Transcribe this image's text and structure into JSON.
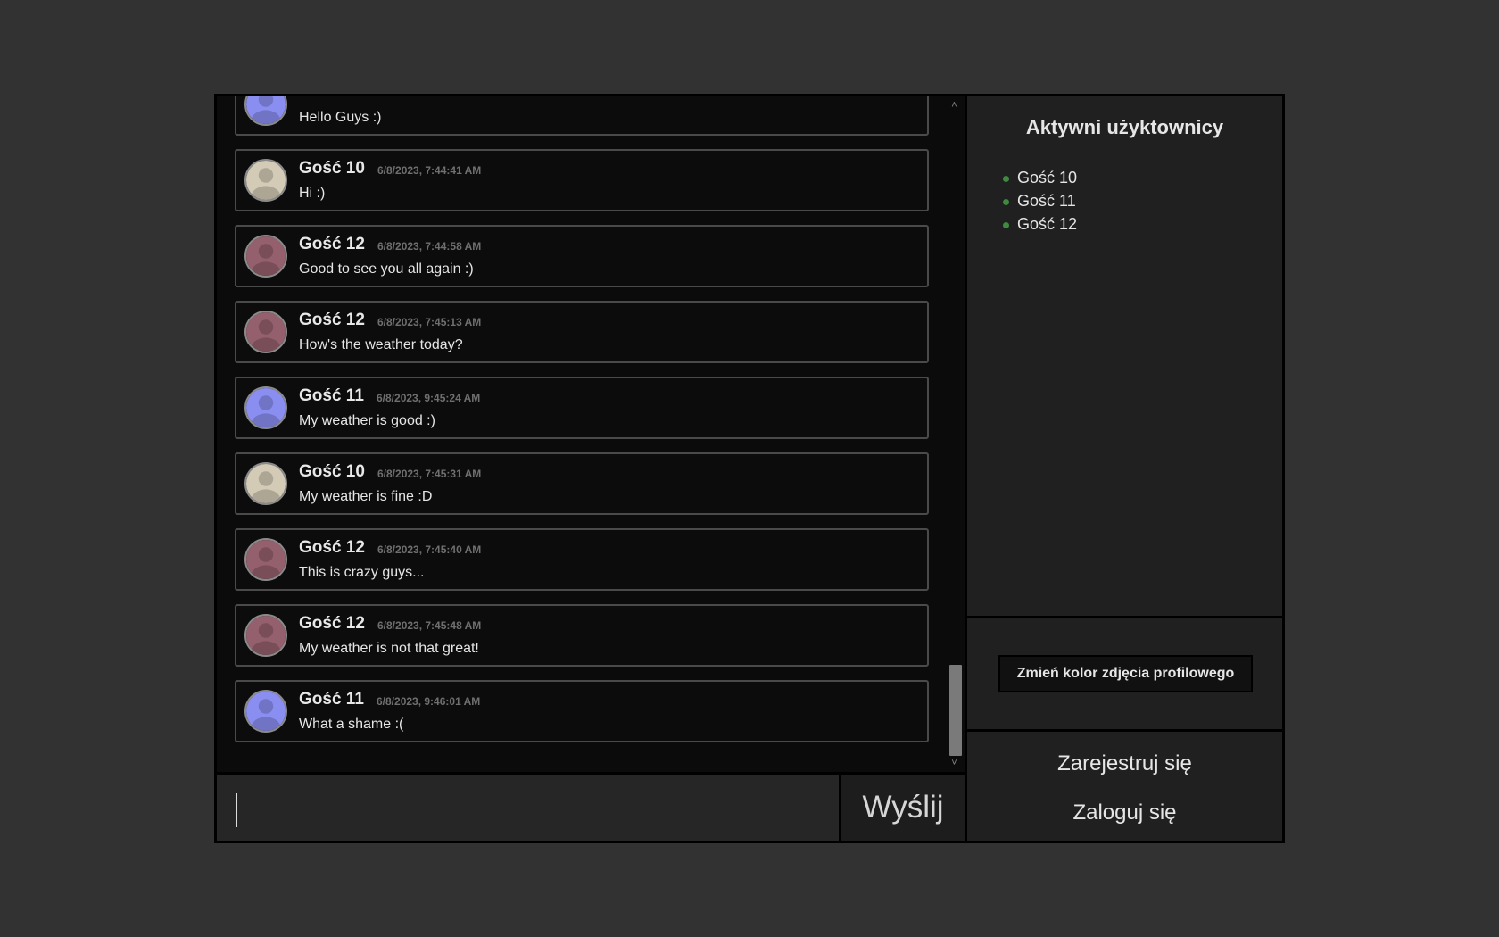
{
  "messages": [
    {
      "author": "",
      "time": "",
      "text": "Hello Guys :)",
      "avatar_color": "#8a8ef0"
    },
    {
      "author": "Gość 10",
      "time": "6/8/2023, 7:44:41 AM",
      "text": "Hi :)",
      "avatar_color": "#d3cbb5"
    },
    {
      "author": "Gość 12",
      "time": "6/8/2023, 7:44:58 AM",
      "text": "Good to see you all again :)",
      "avatar_color": "#94606d"
    },
    {
      "author": "Gość 12",
      "time": "6/8/2023, 7:45:13 AM",
      "text": "How's the weather today?",
      "avatar_color": "#94606d"
    },
    {
      "author": "Gość 11",
      "time": "6/8/2023, 9:45:24 AM",
      "text": "My weather is good :)",
      "avatar_color": "#8a8ef0"
    },
    {
      "author": "Gość 10",
      "time": "6/8/2023, 7:45:31 AM",
      "text": "My weather is fine :D",
      "avatar_color": "#d3cbb5"
    },
    {
      "author": "Gość 12",
      "time": "6/8/2023, 7:45:40 AM",
      "text": "This is crazy guys...",
      "avatar_color": "#94606d"
    },
    {
      "author": "Gość 12",
      "time": "6/8/2023, 7:45:48 AM",
      "text": "My weather is not that great!",
      "avatar_color": "#94606d"
    },
    {
      "author": "Gość 11",
      "time": "6/8/2023, 9:46:01 AM",
      "text": "What a shame :(",
      "avatar_color": "#8a8ef0"
    }
  ],
  "composer": {
    "input_value": "",
    "send_label": "Wyślij"
  },
  "sidebar": {
    "title": "Aktywni użyktownicy",
    "users": [
      "Gość 10",
      "Gość 11",
      "Gość 12"
    ],
    "online_color": "#3f8a3f",
    "change_color_label": "Zmień kolor zdjęcia profilowego",
    "register_label": "Zarejestruj się",
    "login_label": "Zaloguj się"
  },
  "scroll": {
    "up_icon": "chevron-up-icon",
    "down_icon": "chevron-down-icon",
    "position_fraction": 1.0
  }
}
